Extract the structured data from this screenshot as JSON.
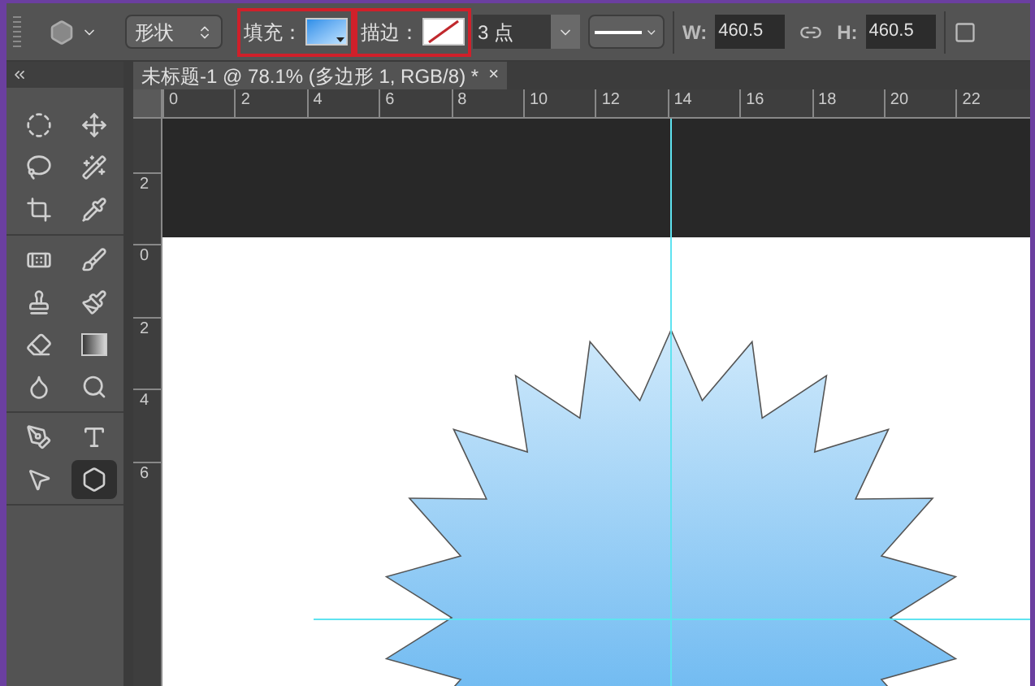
{
  "options_bar": {
    "mode": "形状",
    "fill": {
      "label": "填充：",
      "highlighted": true
    },
    "stroke": {
      "label": "描边：",
      "highlighted": true
    },
    "stroke_width": "3 点",
    "width": {
      "label": "W:",
      "value": "460.5"
    },
    "height": {
      "label": "H:",
      "value": "460.5"
    }
  },
  "document_tab": {
    "title": "未标题-1 @ 78.1% (多边形 1, RGB/8) *",
    "close": "×"
  },
  "rulers": {
    "horizontal": [
      "0",
      "2",
      "4",
      "6",
      "8",
      "10",
      "12",
      "14",
      "16",
      "18",
      "20",
      "22"
    ],
    "vertical": [
      "2",
      "0",
      "2",
      "4",
      "6"
    ]
  },
  "tools": [
    [
      {
        "kind": "marquee",
        "selected": false
      },
      {
        "kind": "move",
        "selected": false
      },
      {
        "kind": "lasso",
        "selected": false
      },
      {
        "kind": "wand",
        "selected": false
      },
      {
        "kind": "crop",
        "selected": false
      },
      {
        "kind": "eyedropper",
        "selected": false
      }
    ],
    [
      {
        "kind": "healing",
        "selected": false
      },
      {
        "kind": "brush",
        "selected": false
      },
      {
        "kind": "stamp",
        "selected": false
      },
      {
        "kind": "history",
        "selected": false
      },
      {
        "kind": "eraser",
        "selected": false
      },
      {
        "kind": "gradient",
        "selected": false
      },
      {
        "kind": "blur",
        "selected": false
      },
      {
        "kind": "dodge",
        "selected": false
      }
    ],
    [
      {
        "kind": "pen",
        "selected": false
      },
      {
        "kind": "type",
        "selected": false
      },
      {
        "kind": "select",
        "selected": false
      },
      {
        "kind": "shape",
        "selected": true
      }
    ]
  ]
}
